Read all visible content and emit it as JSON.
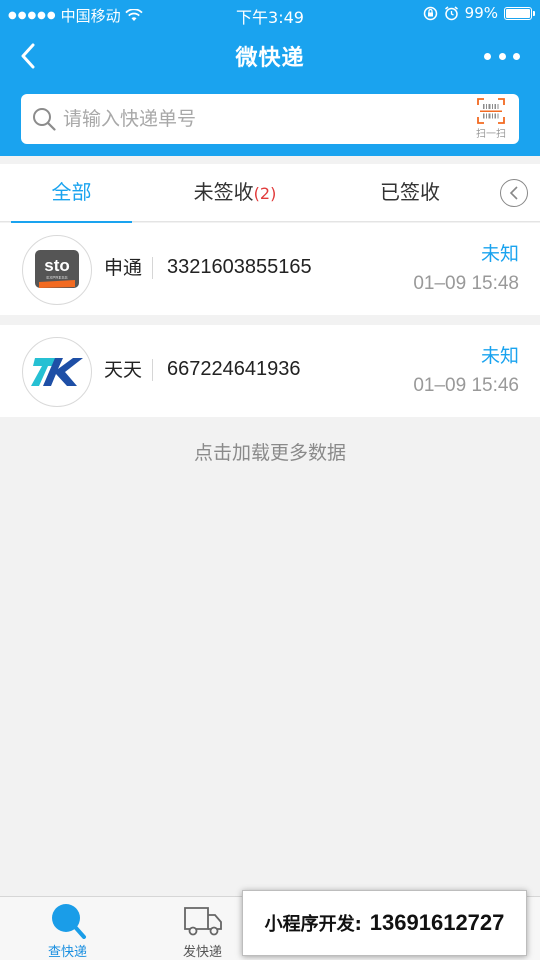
{
  "status_bar": {
    "carrier": "中国移动",
    "time": "下午3:49",
    "battery": "99%"
  },
  "nav": {
    "title": "微快递"
  },
  "search": {
    "placeholder": "请输入快递单号",
    "value": "",
    "scan_label": "扫一扫"
  },
  "tabs": [
    {
      "label": "全部",
      "count": ""
    },
    {
      "label": "未签收",
      "count": "(2)"
    },
    {
      "label": "已签收",
      "count": ""
    }
  ],
  "packages": [
    {
      "company": "申通",
      "tracking_no": "3321603855165",
      "status": "未知",
      "time": "01–09 15:48",
      "logo": "sto-logo",
      "logo_text": "sto",
      "logo_subtext": "EXPRESS"
    },
    {
      "company": "天天",
      "tracking_no": "667224641936",
      "status": "未知",
      "time": "01–09 15:46",
      "logo": "tiantian-logo"
    }
  ],
  "load_more": "点击加载更多数据",
  "bottom_nav": [
    {
      "label": "查快递",
      "icon": "search-icon"
    },
    {
      "label": "发快递",
      "icon": "truck-icon"
    }
  ],
  "ad": {
    "label": "小程序开发:",
    "phone": "13691612727"
  },
  "colors": {
    "brand": "#1aa3ef",
    "badge": "#e13b3b",
    "sto_orange": "#f26a21"
  }
}
